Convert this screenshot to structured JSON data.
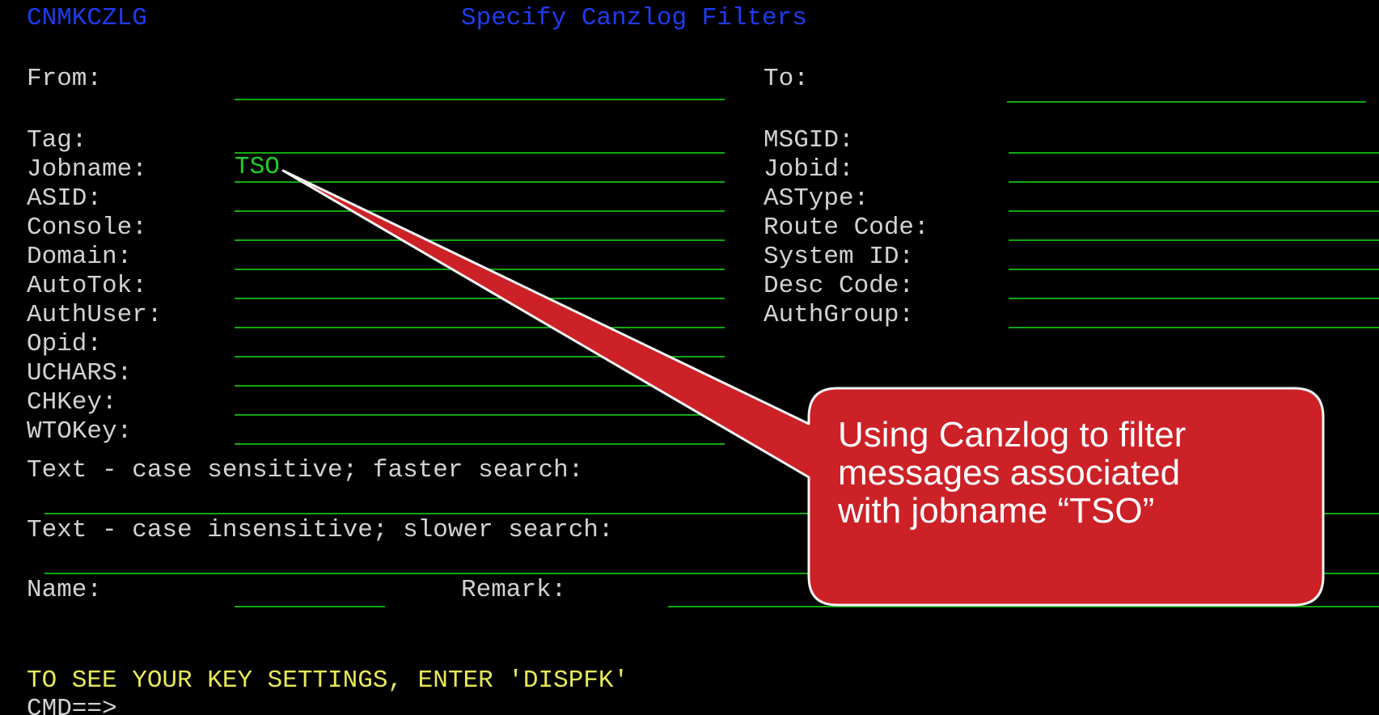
{
  "header": {
    "panel_id": "CNMKCZLG",
    "title": "Specify Canzlog Filters"
  },
  "left_fields": [
    {
      "label": "From:",
      "value": ""
    },
    {
      "label": "Tag:",
      "value": ""
    },
    {
      "label": "Jobname:",
      "value": "TSO"
    },
    {
      "label": "ASID:",
      "value": ""
    },
    {
      "label": "Console:",
      "value": ""
    },
    {
      "label": "Domain:",
      "value": ""
    },
    {
      "label": "AutoTok:",
      "value": ""
    },
    {
      "label": "AuthUser:",
      "value": ""
    },
    {
      "label": "Opid:",
      "value": ""
    },
    {
      "label": "UCHARS:",
      "value": ""
    },
    {
      "label": "CHKey:",
      "value": ""
    },
    {
      "label": "WTOKey:",
      "value": ""
    }
  ],
  "right_fields": [
    {
      "label": "To:",
      "value": ""
    },
    {
      "label": "MSGID:",
      "value": ""
    },
    {
      "label": "Jobid:",
      "value": ""
    },
    {
      "label": "ASType:",
      "value": ""
    },
    {
      "label": "Route Code:",
      "value": ""
    },
    {
      "label": "System ID:",
      "value": ""
    },
    {
      "label": "Desc Code:",
      "value": ""
    },
    {
      "label": "AuthGroup:",
      "value": ""
    }
  ],
  "text_sensitive": {
    "label": "Text - case sensitive; faster search:",
    "value": ""
  },
  "text_insensitive": {
    "label": "Text - case insensitive; slower search:",
    "value": ""
  },
  "name": {
    "label": "Name:",
    "value": ""
  },
  "remark": {
    "label": "Remark:",
    "value": ""
  },
  "message": "TO SEE YOUR KEY SETTINGS, ENTER 'DISPFK'",
  "command": {
    "prompt": "CMD==>",
    "value": ""
  },
  "callout": {
    "line1": "Using Canzlog to filter",
    "line2": "messages associated",
    "line3": "with jobname “TSO”"
  },
  "colors": {
    "background": "#000000",
    "label": "#d2d2d2",
    "field_underline": "#11a810",
    "header": "#1e3cf0",
    "message": "#e8e85a",
    "callout_fill": "#cc2127"
  }
}
